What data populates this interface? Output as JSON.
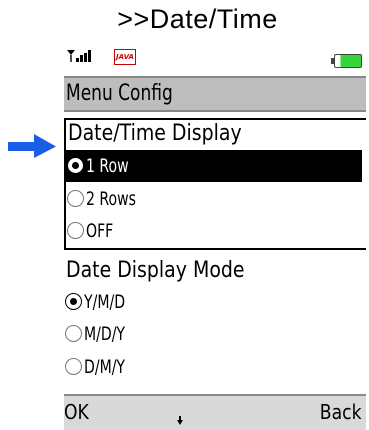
{
  "caption": ">>Date/Time",
  "status": {
    "java_label": "JAVA",
    "battery_level": 0.78
  },
  "title": "Menu Config",
  "sections": [
    {
      "title": "Date/Time Display",
      "options": [
        "1 Row",
        "2 Rows",
        "OFF"
      ],
      "selected": 0
    },
    {
      "title": "Date Display Mode",
      "options": [
        "Y/M/D",
        "M/D/Y",
        "D/M/Y"
      ],
      "selected": 0
    }
  ],
  "softkeys": {
    "left": "OK",
    "right": "Back"
  },
  "colors": {
    "pointer_arrow": "#1a5de8",
    "battery_fill": "#35d43a",
    "titlebar_bg": "#bdbdbd",
    "softkey_bg": "#d9d9d9",
    "highlight_bg": "#000000"
  }
}
